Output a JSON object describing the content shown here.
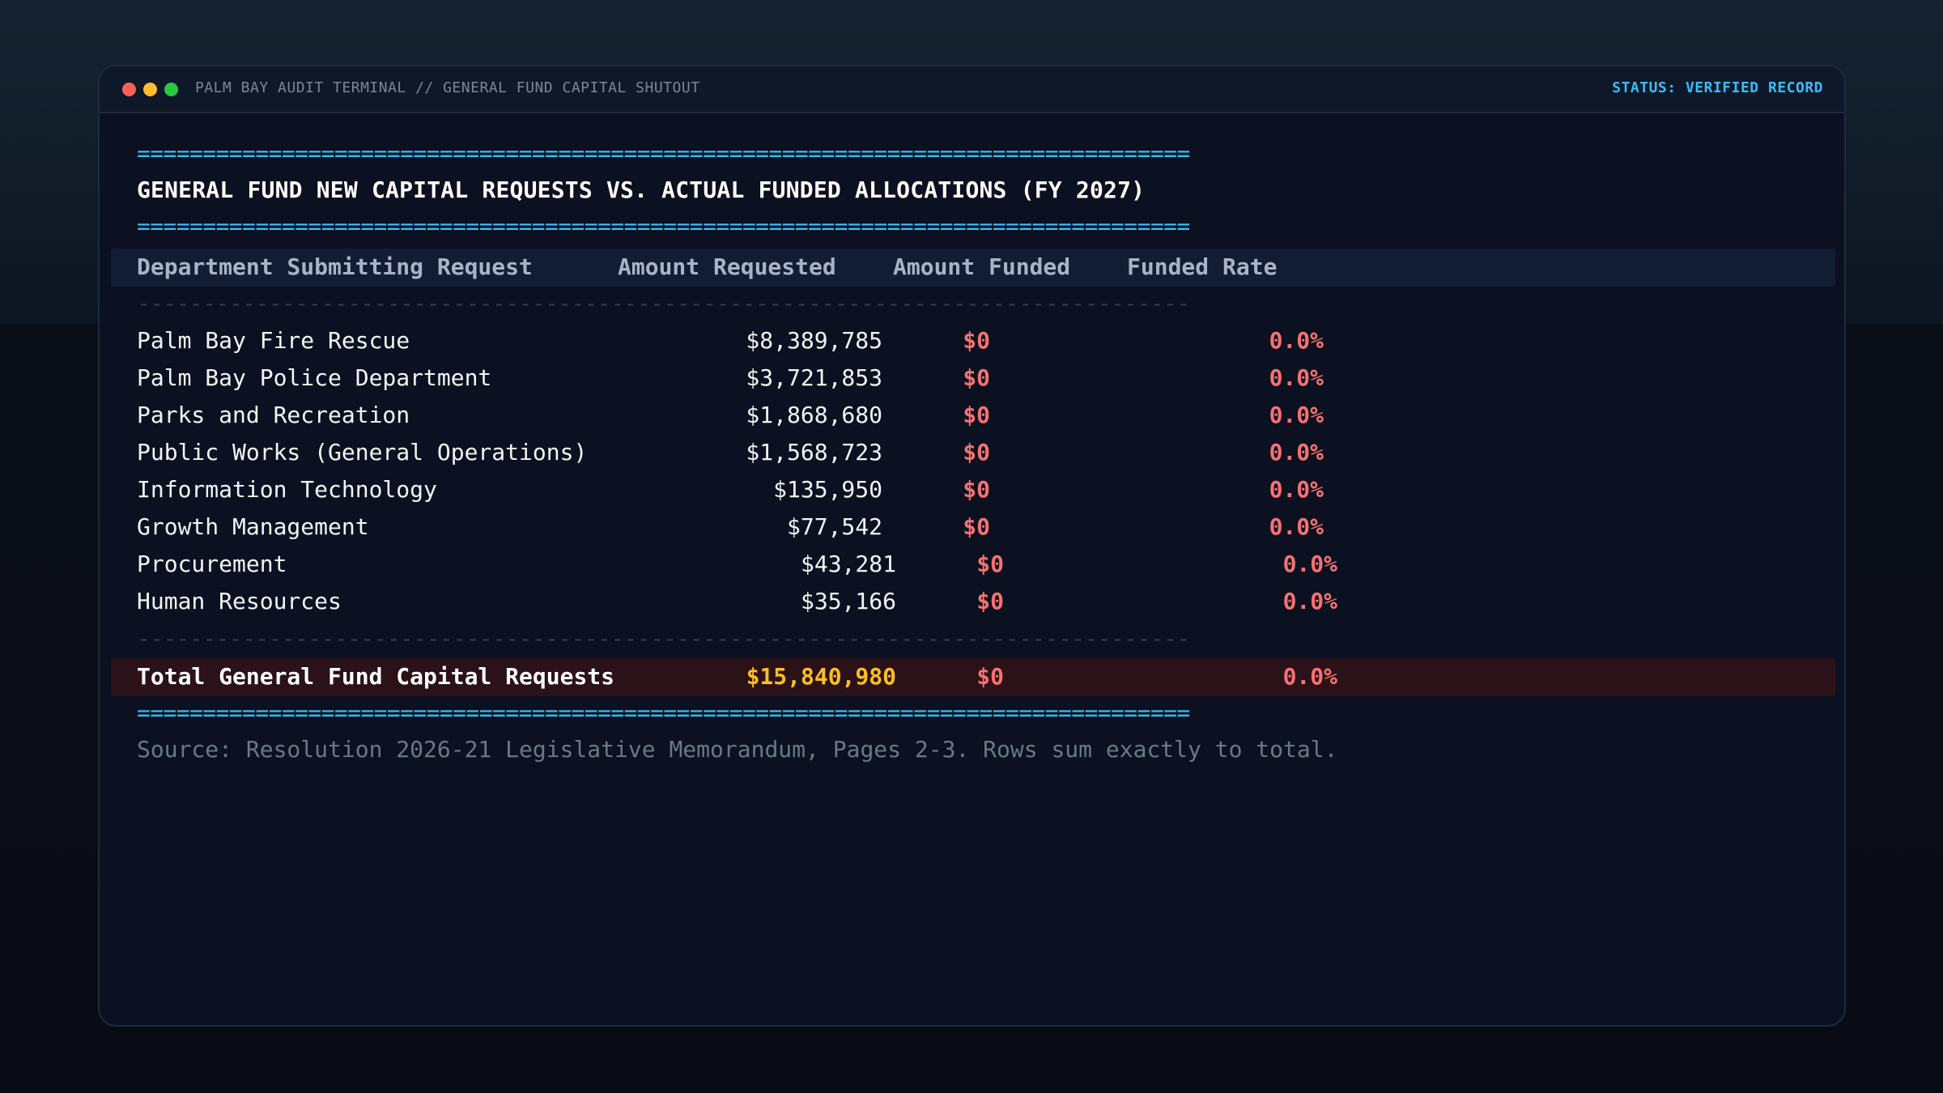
{
  "window": {
    "title": "PALM BAY AUDIT TERMINAL // GENERAL FUND CAPITAL SHUTOUT",
    "status": "STATUS: VERIFIED RECORD"
  },
  "report": {
    "rule_equals": "================================================================================",
    "rule_dashes": "--------------------------------------------------------------------------------",
    "title": "GENERAL FUND NEW CAPITAL REQUESTS VS. ACTUAL FUNDED ALLOCATIONS (FY 2027)",
    "columns": {
      "department": "Department Submitting Request",
      "requested": "Amount Requested",
      "funded": "Amount Funded",
      "rate": "Funded Rate"
    },
    "rows": [
      {
        "department": "Palm Bay Fire Rescue",
        "requested": "$8,389,785",
        "funded": "$0",
        "rate": "0.0%"
      },
      {
        "department": "Palm Bay Police Department",
        "requested": "$3,721,853",
        "funded": "$0",
        "rate": "0.0%"
      },
      {
        "department": "Parks and Recreation",
        "requested": "$1,868,680",
        "funded": "$0",
        "rate": "0.0%"
      },
      {
        "department": "Public Works (General Operations)",
        "requested": "$1,568,723",
        "funded": "$0",
        "rate": "0.0%"
      },
      {
        "department": "Information Technology",
        "requested": "$135,950",
        "funded": "$0",
        "rate": "0.0%"
      },
      {
        "department": "Growth Management",
        "requested": "$77,542",
        "funded": "$0",
        "rate": "0.0%"
      },
      {
        "department": "Procurement",
        "requested": "$43,281",
        "funded": "$0",
        "rate": "0.0%"
      },
      {
        "department": "Human Resources",
        "requested": "$35,166",
        "funded": "$0",
        "rate": "0.0%"
      }
    ],
    "total": {
      "label": "Total General Fund Capital Requests",
      "requested": "$15,840,980",
      "funded": "$0",
      "rate": "0.0%"
    },
    "source": "Source: Resolution 2026-21 Legislative Memorandum, Pages 2-3. Rows sum exactly to total."
  },
  "colors": {
    "accent": "#38bdf8",
    "zero_value": "#f87171",
    "total_value": "#fbbf24",
    "total_band": "#2b1218"
  }
}
